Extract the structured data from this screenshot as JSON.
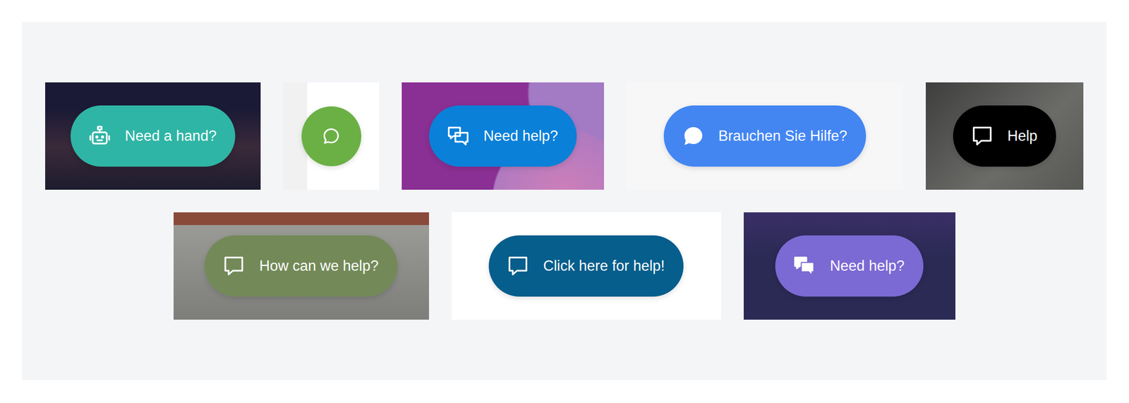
{
  "showcase": {
    "rows": [
      [
        {
          "label": "Need a hand?",
          "kind": "robot",
          "color": "#2fb5a5"
        },
        {
          "kind": "round",
          "color": "#6bb045"
        },
        {
          "label": "Need help?",
          "kind": "stacked",
          "color": "#0a80d8"
        },
        {
          "label": "Brauchen Sie Hilfe?",
          "kind": "solid",
          "color": "#4386f2"
        },
        {
          "label": "Help",
          "kind": "square",
          "color": "#000000"
        }
      ],
      [
        {
          "label": "How can we help?",
          "kind": "square",
          "color": "#738a58"
        },
        {
          "label": "Click here for help!",
          "kind": "square",
          "color": "#065e8c"
        },
        {
          "label": "Need help?",
          "kind": "stacked-solid",
          "color": "#7b69d4"
        }
      ]
    ]
  }
}
